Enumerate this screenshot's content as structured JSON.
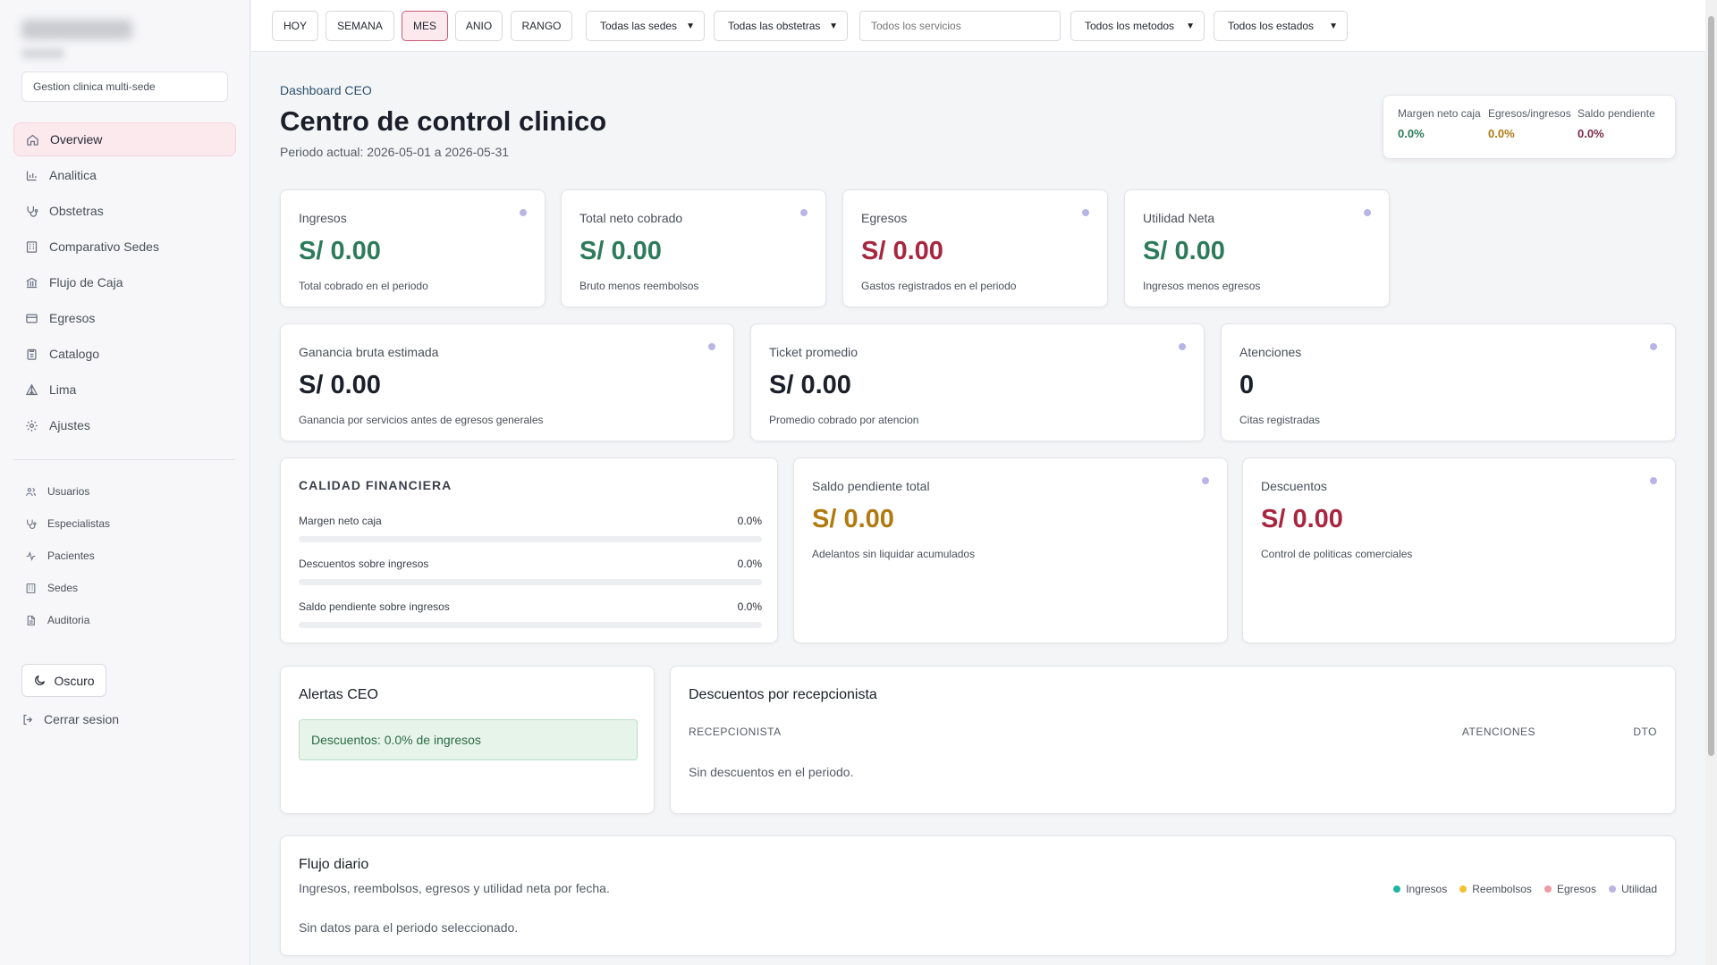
{
  "sidebar": {
    "context": "Gestion clinica multi-sede",
    "nav": [
      {
        "label": "Overview",
        "icon": "home-icon"
      },
      {
        "label": "Analitica",
        "icon": "bar-chart-icon"
      },
      {
        "label": "Obstetras",
        "icon": "stethoscope-icon"
      },
      {
        "label": "Comparativo Sedes",
        "icon": "building-icon"
      },
      {
        "label": "Flujo de Caja",
        "icon": "bank-icon"
      },
      {
        "label": "Egresos",
        "icon": "credit-card-icon"
      },
      {
        "label": "Catalogo",
        "icon": "clipboard-icon"
      },
      {
        "label": "Lima",
        "icon": "tent-icon"
      },
      {
        "label": "Ajustes",
        "icon": "gear-icon"
      }
    ],
    "subnav": [
      {
        "label": "Usuarios",
        "icon": "users-icon"
      },
      {
        "label": "Especialistas",
        "icon": "stethoscope-icon"
      },
      {
        "label": "Pacientes",
        "icon": "activity-icon"
      },
      {
        "label": "Sedes",
        "icon": "building-icon"
      },
      {
        "label": "Auditoria",
        "icon": "document-icon"
      }
    ],
    "dark_mode_label": "Oscuro",
    "logout_label": "Cerrar sesion"
  },
  "filters": {
    "range_buttons": [
      "HOY",
      "SEMANA",
      "MES",
      "ANIO",
      "RANGO"
    ],
    "active_range": "MES",
    "sedes": "Todas las sedes",
    "obstetras": "Todas las obstetras",
    "servicios_placeholder": "Todos los servicios",
    "metodos": "Todos los metodos",
    "estados": "Todos los estados"
  },
  "header": {
    "eyebrow": "Dashboard CEO",
    "title": "Centro de control clinico",
    "period": "Periodo actual: 2026-05-01 a 2026-05-31"
  },
  "summary": {
    "margen_label": "Margen neto caja",
    "margen_value": "0.0%",
    "egresos_label": "Egresos/ingresos",
    "egresos_value": "0.0%",
    "saldo_label": "Saldo pendiente",
    "saldo_value": "0.0%"
  },
  "kpis_row1": [
    {
      "title": "Ingresos",
      "value": "S/ 0.00",
      "desc": "Total cobrado en el periodo"
    },
    {
      "title": "Total neto cobrado",
      "value": "S/ 0.00",
      "desc": "Bruto menos reembolsos"
    },
    {
      "title": "Egresos",
      "value": "S/ 0.00",
      "desc": "Gastos registrados en el periodo"
    },
    {
      "title": "Utilidad Neta",
      "value": "S/ 0.00",
      "desc": "Ingresos menos egresos"
    }
  ],
  "kpis_row2": [
    {
      "title": "Ganancia bruta estimada",
      "value": "S/ 0.00",
      "desc": "Ganancia por servicios antes de egresos generales"
    },
    {
      "title": "Ticket promedio",
      "value": "S/ 0.00",
      "desc": "Promedio cobrado por atencion"
    },
    {
      "title": "Atenciones",
      "value": "0",
      "desc": "Citas registradas"
    }
  ],
  "calidad": {
    "title": "CALIDAD FINANCIERA",
    "rows": [
      {
        "label": "Margen neto caja",
        "value": "0.0%",
        "fraction": 0
      },
      {
        "label": "Descuentos sobre ingresos",
        "value": "0.0%",
        "fraction": 0
      },
      {
        "label": "Saldo pendiente sobre ingresos",
        "value": "0.0%",
        "fraction": 0
      }
    ]
  },
  "saldo_card": {
    "title": "Saldo pendiente total",
    "value": "S/ 0.00",
    "desc": "Adelantos sin liquidar acumulados"
  },
  "descuentos_card": {
    "title": "Descuentos",
    "value": "S/ 0.00",
    "desc": "Control de politicas comerciales"
  },
  "alertas": {
    "title": "Alertas CEO",
    "message": "Descuentos: 0.0% de ingresos"
  },
  "descuentos_tabla": {
    "title": "Descuentos por recepcionista",
    "columns": [
      "RECEPCIONISTA",
      "ATENCIONES",
      "DTO"
    ],
    "empty": "Sin descuentos en el periodo."
  },
  "flujo": {
    "title": "Flujo diario",
    "subtitle": "Ingresos, reembolsos, egresos y utilidad neta por fecha.",
    "empty": "Sin datos para el periodo seleccionado.",
    "legend": [
      {
        "label": "Ingresos",
        "color": "#1fb5a0"
      },
      {
        "label": "Reembolsos",
        "color": "#f2c233"
      },
      {
        "label": "Egresos",
        "color": "#f09aa6"
      },
      {
        "label": "Utilidad",
        "color": "#b9b4e6"
      }
    ]
  }
}
